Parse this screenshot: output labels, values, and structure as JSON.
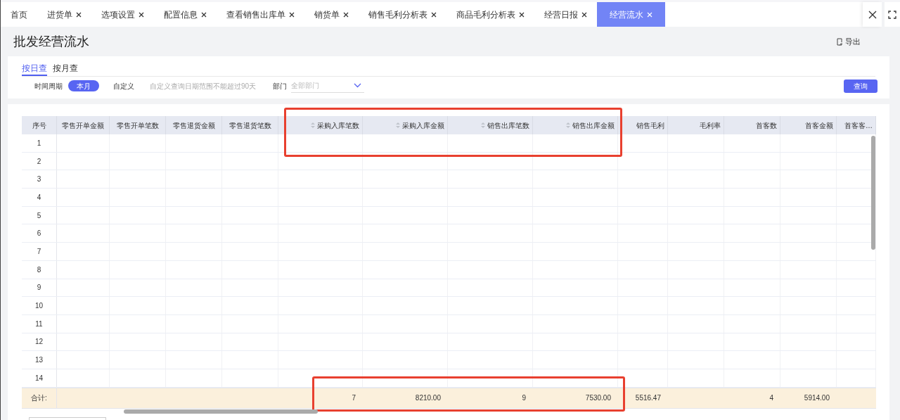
{
  "tabs": [
    {
      "label": "首页",
      "closable": false,
      "selected": false
    },
    {
      "label": "进货单",
      "closable": true,
      "selected": false
    },
    {
      "label": "选项设置",
      "closable": true,
      "selected": false
    },
    {
      "label": "配置信息",
      "closable": true,
      "selected": false
    },
    {
      "label": "查看销售出库单",
      "closable": true,
      "selected": false
    },
    {
      "label": "销货单",
      "closable": true,
      "selected": false
    },
    {
      "label": "销售毛利分析表",
      "closable": true,
      "selected": false
    },
    {
      "label": "商品毛利分析表",
      "closable": true,
      "selected": false
    },
    {
      "label": "经营日报",
      "closable": true,
      "selected": false
    },
    {
      "label": "经营流水",
      "closable": true,
      "selected": true
    }
  ],
  "page_title": "批发经营流水",
  "export_button": "导出",
  "query_modes": [
    {
      "label": "按日查",
      "selected": true
    },
    {
      "label": "按月查",
      "selected": false
    }
  ],
  "filters": {
    "period_label": "时间周期",
    "period_options": [
      {
        "label": "本月",
        "selected": true
      },
      {
        "label": "自定义",
        "selected": false
      }
    ],
    "hint": "自定义查询日期范围不能超过90天",
    "department_label": "部门",
    "department_select": {
      "placeholder": "全部部门"
    }
  },
  "query_button": "查询",
  "highlight_frames": {
    "header": true,
    "totals": true
  },
  "table": {
    "columns": [
      {
        "label": "序号",
        "sortable": false
      },
      {
        "label": "零售开单金额",
        "sortable": false
      },
      {
        "label": "零售开单笔数",
        "sortable": false
      },
      {
        "label": "零售退货金额",
        "sortable": false
      },
      {
        "label": "零售退货笔数",
        "sortable": false
      },
      {
        "label": "采购入库笔数",
        "sortable": true
      },
      {
        "label": "采购入库金额",
        "sortable": true
      },
      {
        "label": "销售出库笔数",
        "sortable": true
      },
      {
        "label": "销售出库金额",
        "sortable": true
      },
      {
        "label": "销售毛利",
        "sortable": false
      },
      {
        "label": "毛利率",
        "sortable": false
      },
      {
        "label": "首客数",
        "sortable": false
      },
      {
        "label": "首客金额",
        "sortable": false
      },
      {
        "label": "首客客…",
        "sortable": false
      }
    ],
    "rows": [
      "1",
      "2",
      "3",
      "4",
      "5",
      "6",
      "7",
      "8",
      "9",
      "10",
      "11",
      "12",
      "13",
      "14"
    ],
    "totals": {
      "label": "合计:",
      "cells": [
        {
          "kind": "blank"
        },
        {
          "kind": "blank"
        },
        {
          "kind": "blank"
        },
        {
          "kind": "blank"
        },
        {
          "kind": "value",
          "value": "7"
        },
        {
          "kind": "value",
          "value": "8210.00"
        },
        {
          "kind": "value",
          "value": "9"
        },
        {
          "kind": "value",
          "value": "7530.00"
        },
        {
          "kind": "value",
          "value": "5516.47"
        },
        {
          "kind": "blank"
        },
        {
          "kind": "value",
          "value": "4"
        },
        {
          "kind": "value",
          "value": "5914.00"
        },
        {
          "kind": "blank"
        }
      ]
    }
  }
}
